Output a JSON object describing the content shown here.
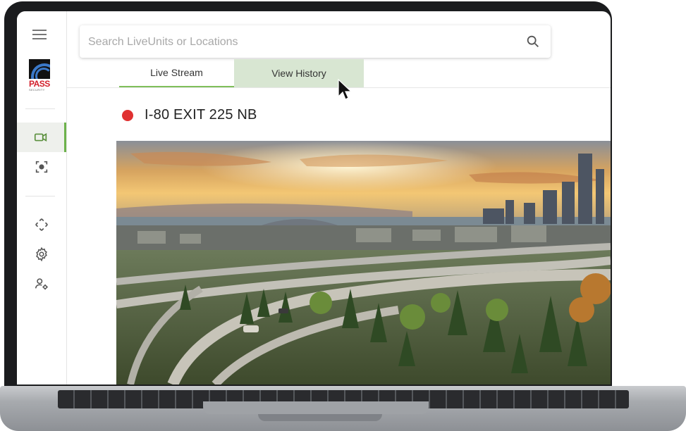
{
  "sidebar": {
    "logo": {
      "brand": "PASS",
      "subtitle": "SECURITY"
    },
    "items": [
      {
        "name": "live-camera",
        "icon": "video-camera-icon",
        "active": true
      },
      {
        "name": "snapshot",
        "icon": "camera-focus-icon",
        "active": false
      },
      {
        "name": "move",
        "icon": "expand-arrows-icon",
        "active": false
      },
      {
        "name": "settings",
        "icon": "gear-icon",
        "active": false
      },
      {
        "name": "user-settings",
        "icon": "user-gear-icon",
        "active": false
      }
    ]
  },
  "search": {
    "placeholder": "Search LiveUnits or Locations",
    "icon": "search-icon"
  },
  "tabs": [
    {
      "label": "Live Stream",
      "active": true
    },
    {
      "label": "View History",
      "active": false
    }
  ],
  "camera": {
    "status_color": "#e03131",
    "name": "I-80 EXIT 225 NB",
    "feed_description": "city-skyline-highway-interchange"
  },
  "colors": {
    "accent": "#6cb24b",
    "tab_highlight": "#d8e6d2"
  }
}
